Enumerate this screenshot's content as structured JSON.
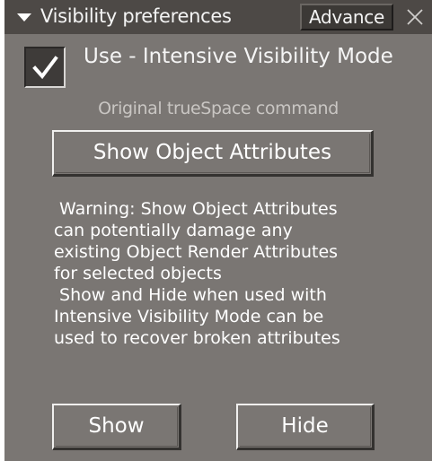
{
  "title_bar": {
    "title": "Visibility preferences",
    "advance_label": "Advance",
    "close_icon": "close-icon"
  },
  "intensive_mode": {
    "checked": true,
    "label": "Use -  Intensive Visibility Mode"
  },
  "command": {
    "caption": "Original trueSpace command",
    "show_attributes_label": "Show Object Attributes"
  },
  "warning_lines": [
    " Warning: Show Object Attributes",
    "can potentially damage any",
    "existing Object Render Attributes",
    "for selected objects",
    " Show and Hide when used with",
    "Intensive Visibility Mode can be",
    "used to recover broken attributes"
  ],
  "buttons": {
    "show_label": "Show",
    "hide_label": "Hide"
  },
  "colors": {
    "panel_bg": "#7a7673",
    "title_bar_bg": "#4d4946",
    "text": "#ffffff"
  }
}
